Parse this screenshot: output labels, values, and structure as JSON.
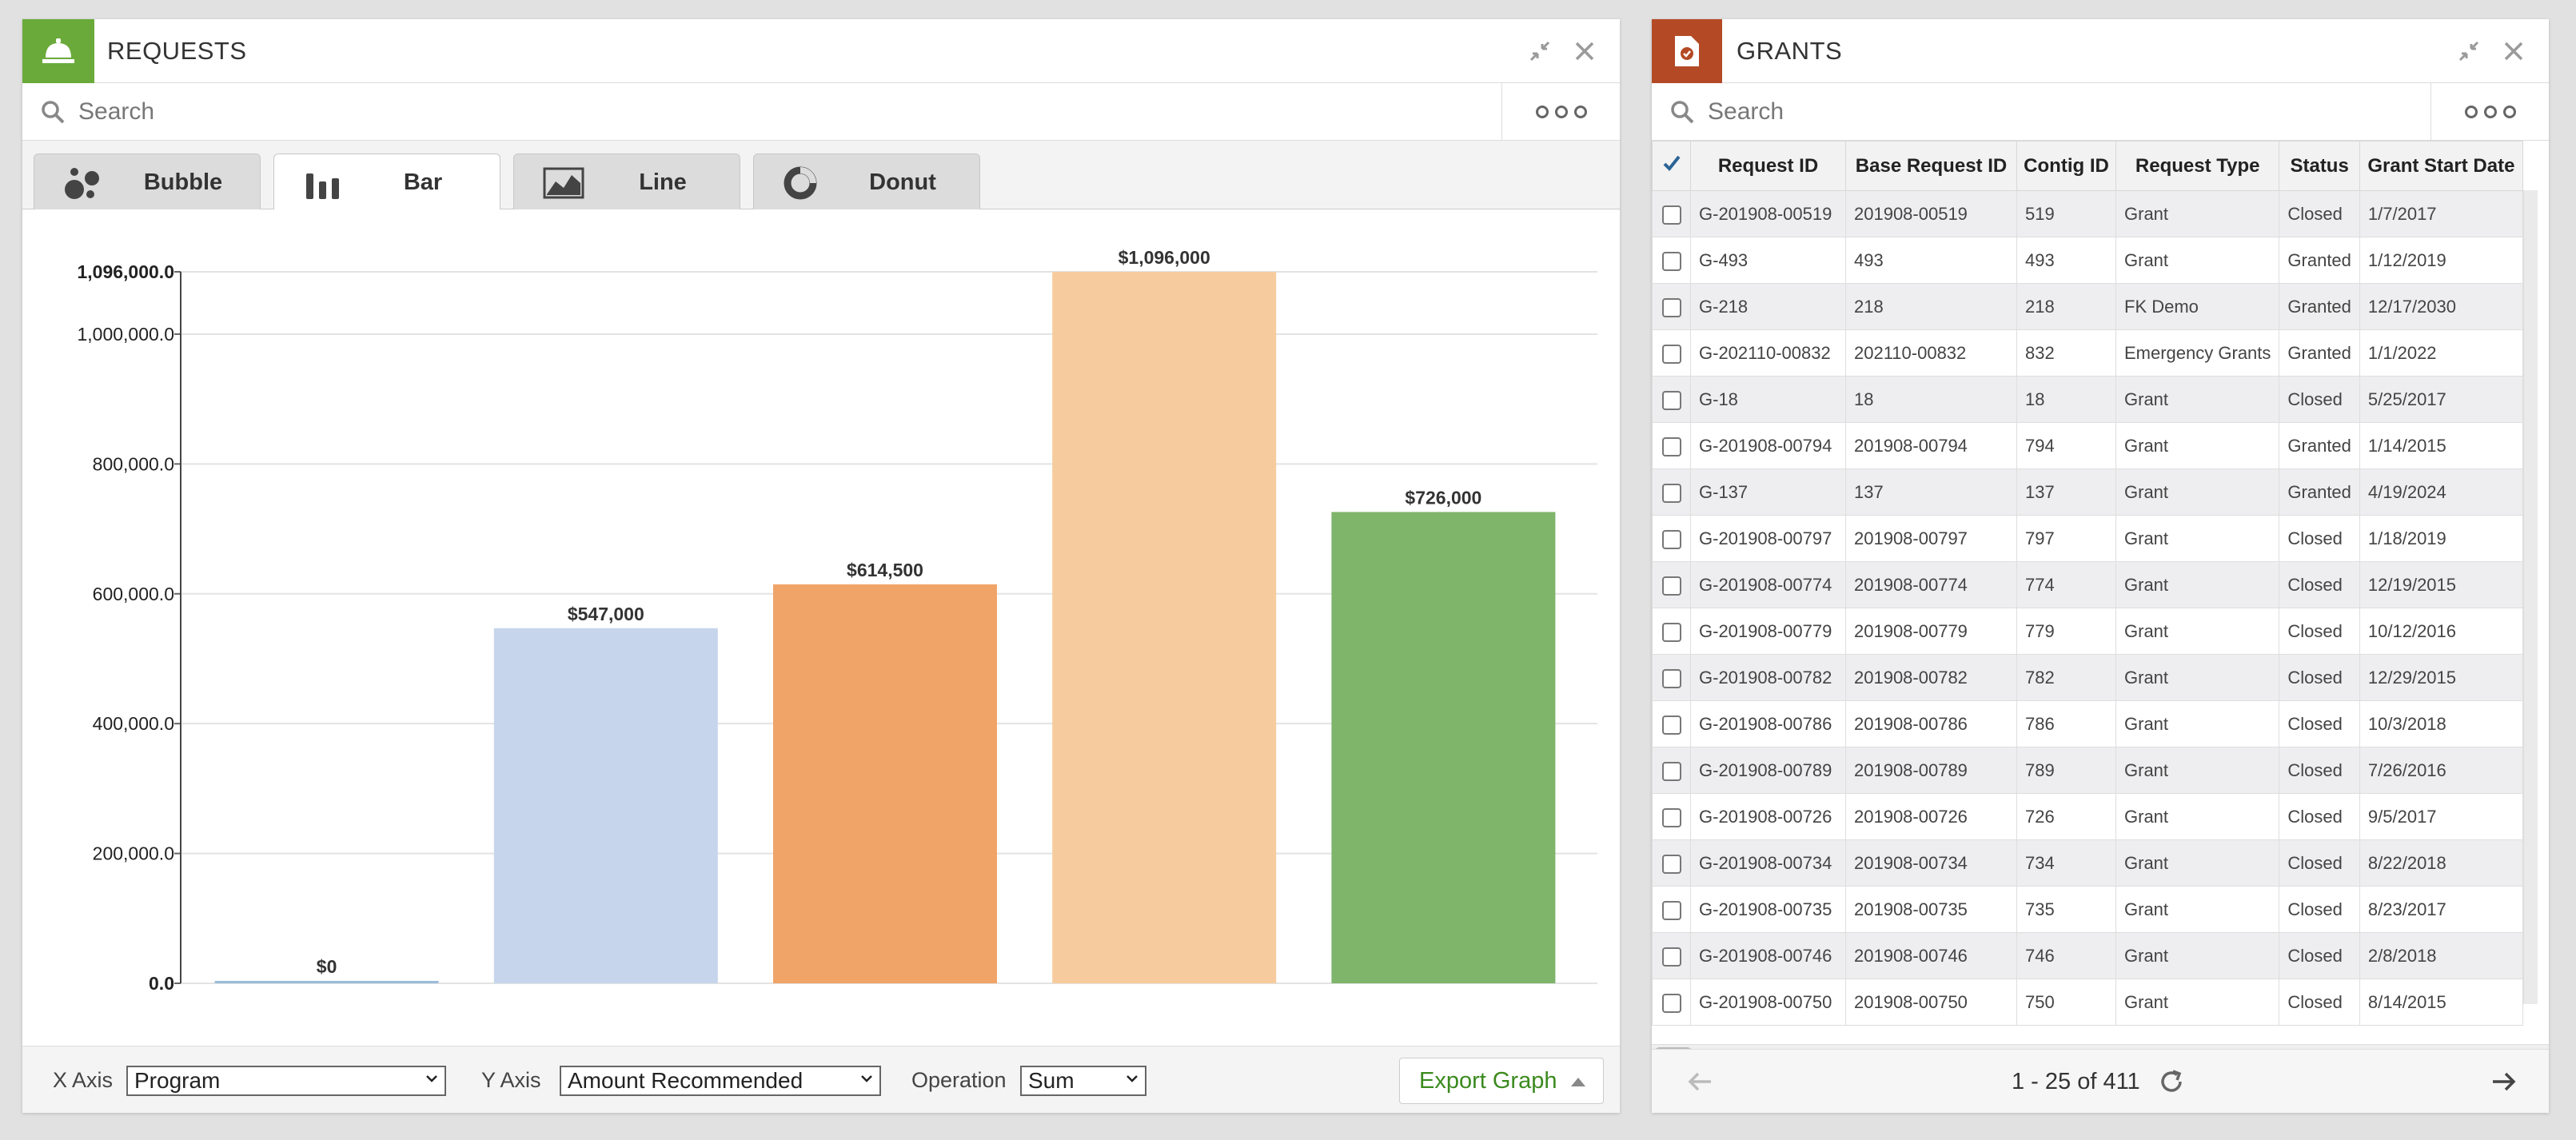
{
  "requests": {
    "title": "REQUESTS",
    "header_color": "#6aaa3a",
    "search_placeholder": "Search",
    "tabs": [
      {
        "label": "Bubble",
        "icon": "bubble-chart-icon"
      },
      {
        "label": "Bar",
        "icon": "bar-chart-icon",
        "active": true
      },
      {
        "label": "Line",
        "icon": "line-chart-icon"
      },
      {
        "label": "Donut",
        "icon": "donut-chart-icon"
      }
    ],
    "footer": {
      "x_axis_label": "X Axis",
      "x_axis_value": "Program",
      "y_axis_label": "Y Axis",
      "y_axis_value": "Amount Recommended",
      "operation_label": "Operation",
      "operation_value": "Sum",
      "export_label": "Export Graph"
    }
  },
  "chart_data": {
    "type": "bar",
    "ylim": [
      0,
      1096000
    ],
    "yticks": [
      0,
      200000,
      400000,
      600000,
      800000,
      1000000,
      1096000
    ],
    "ytick_labels": [
      "0.0",
      "200,000.0",
      "400,000.0",
      "600,000.0",
      "800,000.0",
      "1,000,000.0",
      "1,096,000.0"
    ],
    "grid": true,
    "values": [
      0,
      547000,
      614500,
      1096000,
      726000
    ],
    "value_labels": [
      "$0",
      "$547,000",
      "$614,500",
      "$1,096,000",
      "$726,000"
    ],
    "colors": [
      "#9bbcd9",
      "#c6d5ec",
      "#f0a468",
      "#f6cc9e",
      "#7fb56a"
    ]
  },
  "grants": {
    "title": "GRANTS",
    "header_color": "#b44a25",
    "search_placeholder": "Search",
    "columns": [
      "Request ID",
      "Base Request ID",
      "Contig ID",
      "Request Type",
      "Status",
      "Grant Start Date"
    ],
    "rows": [
      [
        "G-201908-00519",
        "201908-00519",
        "519",
        "Grant",
        "Closed",
        "1/7/2017"
      ],
      [
        "G-493",
        "493",
        "493",
        "Grant",
        "Granted",
        "1/12/2019"
      ],
      [
        "G-218",
        "218",
        "218",
        "FK Demo",
        "Granted",
        "12/17/2030"
      ],
      [
        "G-202110-00832",
        "202110-00832",
        "832",
        "Emergency Grants",
        "Granted",
        "1/1/2022"
      ],
      [
        "G-18",
        "18",
        "18",
        "Grant",
        "Closed",
        "5/25/2017"
      ],
      [
        "G-201908-00794",
        "201908-00794",
        "794",
        "Grant",
        "Granted",
        "1/14/2015"
      ],
      [
        "G-137",
        "137",
        "137",
        "Grant",
        "Granted",
        "4/19/2024"
      ],
      [
        "G-201908-00797",
        "201908-00797",
        "797",
        "Grant",
        "Closed",
        "1/18/2019"
      ],
      [
        "G-201908-00774",
        "201908-00774",
        "774",
        "Grant",
        "Closed",
        "12/19/2015"
      ],
      [
        "G-201908-00779",
        "201908-00779",
        "779",
        "Grant",
        "Closed",
        "10/12/2016"
      ],
      [
        "G-201908-00782",
        "201908-00782",
        "782",
        "Grant",
        "Closed",
        "12/29/2015"
      ],
      [
        "G-201908-00786",
        "201908-00786",
        "786",
        "Grant",
        "Closed",
        "10/3/2018"
      ],
      [
        "G-201908-00789",
        "201908-00789",
        "789",
        "Grant",
        "Closed",
        "7/26/2016"
      ],
      [
        "G-201908-00726",
        "201908-00726",
        "726",
        "Grant",
        "Closed",
        "9/5/2017"
      ],
      [
        "G-201908-00734",
        "201908-00734",
        "734",
        "Grant",
        "Closed",
        "8/22/2018"
      ],
      [
        "G-201908-00735",
        "201908-00735",
        "735",
        "Grant",
        "Closed",
        "8/23/2017"
      ],
      [
        "G-201908-00746",
        "201908-00746",
        "746",
        "Grant",
        "Closed",
        "2/8/2018"
      ],
      [
        "G-201908-00750",
        "201908-00750",
        "750",
        "Grant",
        "Closed",
        "8/14/2015"
      ]
    ],
    "pager_text": "1 - 25 of 411"
  }
}
